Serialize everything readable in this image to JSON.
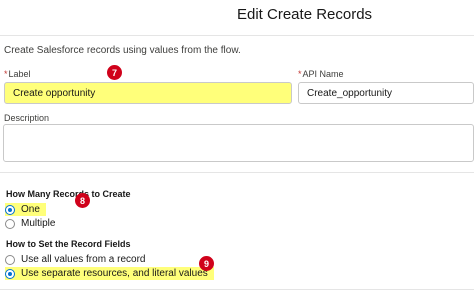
{
  "header": {
    "title": "Edit Create Records"
  },
  "description_text": "Create Salesforce records using values from the flow.",
  "label_field": {
    "required_mark": "*",
    "label": "Label",
    "value": "Create opportunity"
  },
  "api_name_field": {
    "required_mark": "*",
    "label": "API Name",
    "value": "Create_opportunity"
  },
  "description_field": {
    "label": "Description",
    "value": ""
  },
  "how_many": {
    "title": "How Many Records to Create",
    "options": [
      {
        "label": "One",
        "selected": true
      },
      {
        "label": "Multiple",
        "selected": false
      }
    ]
  },
  "set_fields": {
    "title": "How to Set the Record Fields",
    "options": [
      {
        "label": "Use all values from a record",
        "selected": false
      },
      {
        "label": "Use separate resources, and literal values",
        "selected": true
      }
    ]
  },
  "annotations": {
    "badge_7": "7",
    "badge_8": "8",
    "badge_9": "9"
  },
  "colors": {
    "highlight": "#ffff7a",
    "badge": "#d0021b",
    "radio_selected": "#0070d2",
    "required": "#c23934"
  }
}
